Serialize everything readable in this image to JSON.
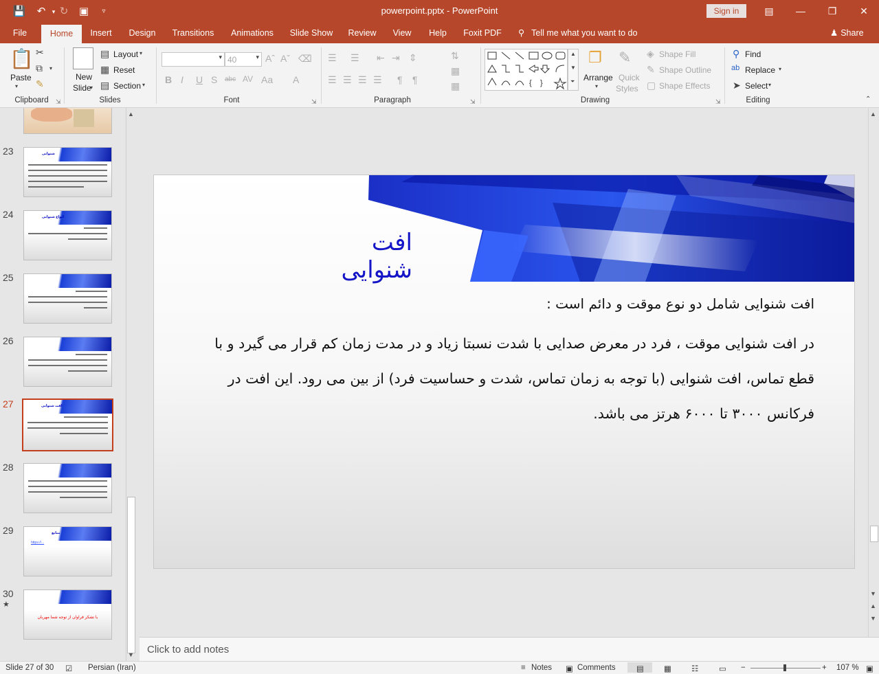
{
  "window": {
    "title": "powerpoint.pptx  -  PowerPoint",
    "sign_in": "Sign in"
  },
  "tabs": [
    "File",
    "Home",
    "Insert",
    "Design",
    "Transitions",
    "Animations",
    "Slide Show",
    "Review",
    "View",
    "Help",
    "Foxit PDF"
  ],
  "active_tab": "Home",
  "tell_me": "Tell me what you want to do",
  "share": "Share",
  "ribbon": {
    "clipboard": {
      "label": "Clipboard",
      "paste": "Paste"
    },
    "slides": {
      "label": "Slides",
      "new_slide_1": "New",
      "new_slide_2": "Slide",
      "layout": "Layout",
      "reset": "Reset",
      "section": "Section"
    },
    "font": {
      "label": "Font",
      "font_name": "",
      "font_size": "40"
    },
    "paragraph": {
      "label": "Paragraph"
    },
    "drawing": {
      "label": "Drawing",
      "arrange": "Arrange",
      "quick_styles_1": "Quick",
      "quick_styles_2": "Styles",
      "shape_fill": "Shape Fill",
      "shape_outline": "Shape Outline",
      "shape_effects": "Shape Effects"
    },
    "editing": {
      "label": "Editing",
      "find": "Find",
      "replace": "Replace",
      "select": "Select"
    }
  },
  "thumbnails": [
    {
      "num": "",
      "kind": "image"
    },
    {
      "num": "23",
      "kind": "text",
      "title": "شنوایی"
    },
    {
      "num": "24",
      "kind": "text",
      "title": "انواع شنوایی"
    },
    {
      "num": "25",
      "kind": "text",
      "title": ""
    },
    {
      "num": "26",
      "kind": "text",
      "title": ""
    },
    {
      "num": "27",
      "kind": "text",
      "title": "افت شنوایی",
      "active": true
    },
    {
      "num": "28",
      "kind": "text",
      "title": ""
    },
    {
      "num": "29",
      "kind": "link",
      "title": "منابع",
      "link": "https://..."
    },
    {
      "num": "30",
      "kind": "thanks",
      "star": "★",
      "text": "با تشکر فراوان از توجه شما مهربان"
    }
  ],
  "slide": {
    "title": "افت شنوایی",
    "lines": [
      "افت شنوایی شامل دو نوع موقت و دائم است :",
      "در افت شنوایی موقت ، فرد در معرض صدایی با شدت نسبتا زیاد و در مدت زمان کم قرار می گیرد و با",
      "قطع تماس، افت شنوایی (با توجه به زمان تماس، شدت و حساسیت فرد) از بین می رود. این افت در",
      "فرکانس ۳۰۰۰ تا ۶۰۰۰ هرتز می باشد."
    ]
  },
  "notes_placeholder": "Click to add notes",
  "status": {
    "slide_of": "Slide 27 of 30",
    "language": "Persian (Iran)",
    "notes": "Notes",
    "comments": "Comments",
    "zoom": "107 %"
  }
}
